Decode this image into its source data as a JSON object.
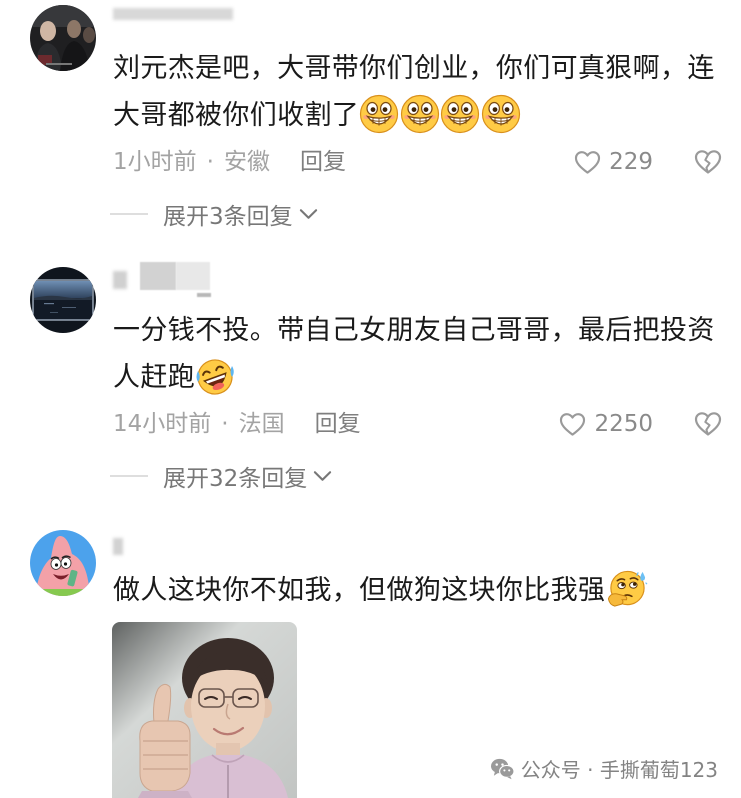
{
  "colors": {
    "background": "#ffffff",
    "text_primary": "#1a1a1a",
    "text_meta": "#a3a3a3",
    "text_action": "#7f7f7f",
    "icon": "#9a9a9a",
    "divider": "#dedede"
  },
  "separator": "·",
  "icons": {
    "like": "heart-outline-icon",
    "dislike": "broken-heart-icon",
    "expand": "chevron-down-icon",
    "watermark": "wechat-icon"
  },
  "comments": [
    {
      "text_lines": [
        "刘元杰是吧，大哥带你们创业，你们可真狠啊，连",
        "大哥都被你们收割了"
      ],
      "emojis": [
        "grin-face-icon",
        "grin-face-icon",
        "grin-face-icon",
        "grin-face-icon"
      ],
      "time": "1小时前",
      "location": "安徽",
      "reply_label": "回复",
      "likes": "229",
      "expand_replies_label": "展开3条回复"
    },
    {
      "text_lines": [
        "一分钱不投。带自己女朋友自己哥哥，最后把投资",
        "人赶跑"
      ],
      "emojis": [
        "laugh-cry-face-icon"
      ],
      "time": "14小时前",
      "location": "法国",
      "reply_label": "回复",
      "likes": "2250",
      "expand_replies_label": "展开32条回复"
    },
    {
      "text_lines": [
        "做人这块你不如我，但做狗这块你比我强"
      ],
      "emojis": [
        "thinking-sweat-face-icon"
      ]
    }
  ],
  "watermark": {
    "text": "公众号 · 手撕葡萄123"
  }
}
